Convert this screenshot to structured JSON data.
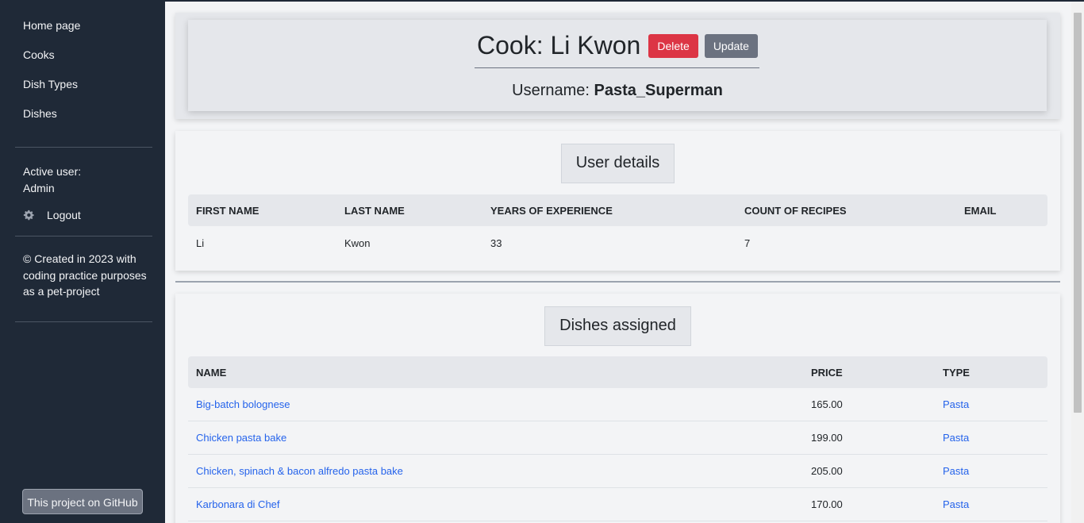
{
  "sidebar": {
    "nav": [
      {
        "label": "Home page"
      },
      {
        "label": "Cooks"
      },
      {
        "label": "Dish Types"
      },
      {
        "label": "Dishes"
      }
    ],
    "active_user_label": "Active user:",
    "active_user_name": "Admin",
    "logout_label": "Logout",
    "footer_note": "© Created in 2023 with coding practice purposes as a pet-project",
    "github_button": "This project on GitHub"
  },
  "header": {
    "title": "Cook: Li Kwon",
    "delete_label": "Delete",
    "update_label": "Update",
    "username_label": "Username:",
    "username_value": "Pasta_Superman"
  },
  "details": {
    "title": "User details",
    "columns": [
      "FIRST NAME",
      "LAST NAME",
      "YEARS OF EXPERIENCE",
      "COUNT OF RECIPES",
      "EMAIL"
    ],
    "row": [
      "Li",
      "Kwon",
      "33",
      "7",
      ""
    ]
  },
  "dishes": {
    "title": "Dishes assigned",
    "columns": [
      "NAME",
      "PRICE",
      "TYPE"
    ],
    "rows": [
      {
        "name": "Big-batch bolognese",
        "price": "165.00",
        "type": "Pasta"
      },
      {
        "name": "Chicken pasta bake",
        "price": "199.00",
        "type": "Pasta"
      },
      {
        "name": "Chicken, spinach & bacon alfredo pasta bake",
        "price": "205.00",
        "type": "Pasta"
      },
      {
        "name": "Karbonara di Chef",
        "price": "170.00",
        "type": "Pasta"
      }
    ]
  },
  "colors": {
    "sidebar_bg": "#1f2937",
    "danger": "#dc3545",
    "secondary": "#6b7280",
    "link": "#2563eb"
  }
}
